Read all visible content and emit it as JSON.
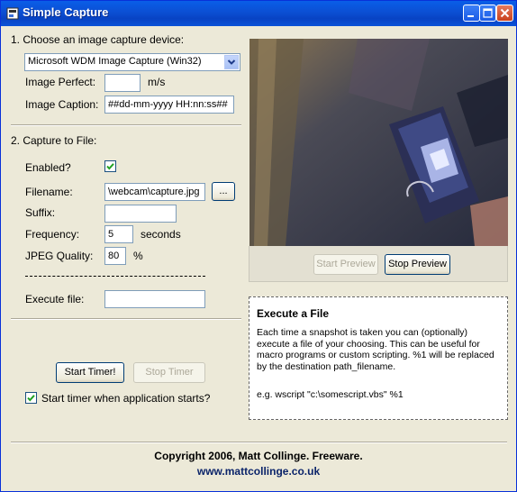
{
  "window": {
    "title": "Simple Capture"
  },
  "section1": {
    "heading": "1. Choose an image capture device:",
    "device_value": "Microsoft WDM Image Capture (Win32)",
    "image_perfect_label": "Image Perfect:",
    "image_perfect_value": "",
    "image_perfect_unit": "m/s",
    "image_caption_label": "Image Caption:",
    "image_caption_value": "##dd-mm-yyyy HH:nn:ss##"
  },
  "section2": {
    "heading": "2. Capture to File:",
    "enabled_label": "Enabled?",
    "enabled_checked": true,
    "filename_label": "Filename:",
    "filename_value": "\\webcam\\capture.jpg",
    "browse_label": "...",
    "suffix_label": "Suffix:",
    "suffix_value": "",
    "frequency_label": "Frequency:",
    "frequency_value": "5",
    "frequency_unit": "seconds",
    "jpeg_label": "JPEG Quality:",
    "jpeg_value": "80",
    "jpeg_unit": "%",
    "execute_label": "Execute file:",
    "execute_value": ""
  },
  "timer": {
    "start_label": "Start Timer!",
    "stop_label": "Stop Timer",
    "autostart_label": "Start timer when application starts?",
    "autostart_checked": true
  },
  "preview": {
    "start_label": "Start Preview",
    "stop_label": "Stop Preview"
  },
  "info": {
    "title": "Execute a File",
    "text": "Each time a snapshot is taken you can (optionally) execute a file of your choosing. This can be useful for macro programs or custom scripting. %1 will be replaced by the destination path_filename.",
    "example": "e.g. wscript \"c:\\somescript.vbs\" %1"
  },
  "footer": {
    "copyright": "Copyright 2006, Matt Collinge. Freeware.",
    "url": "www.mattcollinge.co.uk"
  }
}
